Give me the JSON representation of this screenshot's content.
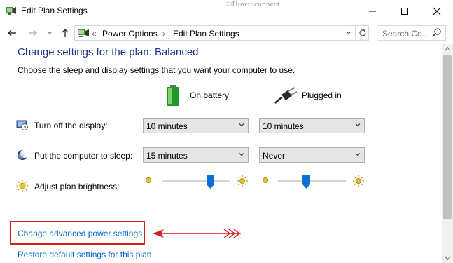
{
  "window": {
    "title": "Edit Plan Settings",
    "watermark": "©Howtoconnect",
    "controls": [
      "minimize",
      "maximize",
      "close"
    ]
  },
  "address_bar": {
    "overflow": "«",
    "breadcrumbs": [
      "Power Options",
      "Edit Plan Settings"
    ],
    "separator": "›",
    "search_placeholder": "Search Co..."
  },
  "main": {
    "heading": "Change settings for the plan: Balanced",
    "description": "Choose the sleep and display settings that you want your computer to use.",
    "columns": {
      "battery": "On battery",
      "plugged": "Plugged in"
    },
    "rows": [
      {
        "label": "Turn off the display:",
        "battery": "10 minutes",
        "plugged": "10 minutes"
      },
      {
        "label": "Put the computer to sleep:",
        "battery": "15 minutes",
        "plugged": "Never"
      }
    ],
    "brightness": {
      "label": "Adjust plan brightness:",
      "battery_level": 0.72,
      "plugged_level": 0.42
    },
    "links": {
      "advanced": "Change advanced power settings",
      "restore": "Restore default settings for this plan"
    }
  },
  "colors": {
    "heading": "#1e3287",
    "link": "#0066cc",
    "highlight": "#d61f1f",
    "slider_thumb": "#0a6fd3"
  }
}
